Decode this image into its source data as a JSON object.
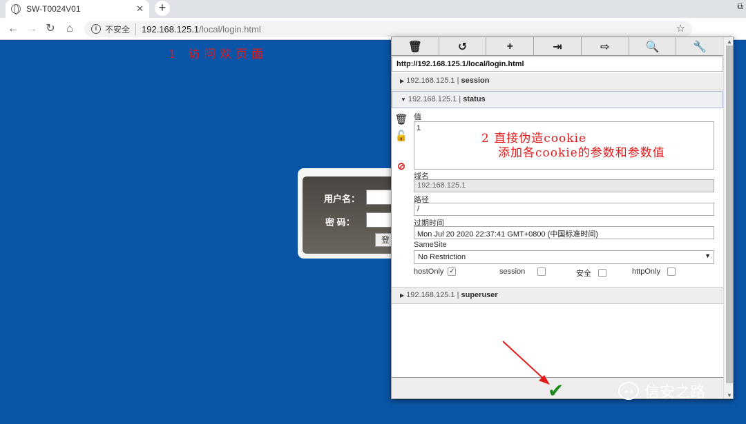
{
  "browser": {
    "tab_title": "SW-T0024V01",
    "tab_close": "✕",
    "new_tab": "+",
    "window_control": "⧉",
    "insecure_label": "不安全",
    "url_host": "192.168.125.1",
    "url_path": "/local/login.html",
    "nav": {
      "back": "←",
      "forward": "→",
      "reload": "↻",
      "home": "⌂"
    },
    "star": "☆",
    "extension_icon": "⚡"
  },
  "page": {
    "annotation_1": "1 访问欢页面",
    "login": {
      "username_label": "用户名：",
      "password_label": "密 码：",
      "login_button": "登"
    }
  },
  "cookie_panel": {
    "toolbar_icons": [
      "trash-icon",
      "undo-icon",
      "plus-icon",
      "import-icon",
      "export-icon",
      "search-icon",
      "wrench-icon"
    ],
    "toolbar_glyphs": [
      "🗑",
      "↺",
      "+",
      "⇥",
      "⇨",
      "🔍",
      "🔧"
    ],
    "url": "http://192.168.125.1/local/login.html",
    "cookies": [
      {
        "host": "192.168.125.1",
        "sep": " | ",
        "name": "session"
      },
      {
        "host": "192.168.125.1",
        "sep": " | ",
        "name": "status"
      },
      {
        "host": "192.168.125.1",
        "sep": " | ",
        "name": "superuser"
      }
    ],
    "side_icons": {
      "delete": "🗑",
      "lock": "🔓",
      "block": "⊘"
    },
    "fields": {
      "value_label": "值",
      "value": "1",
      "domain_label": "域名",
      "domain": "192.168.125.1",
      "path_label": "路径",
      "path": "/",
      "expires_label": "过期时间",
      "expires": "Mon Jul 20 2020 22:37:41 GMT+0800 (中国标准时间)",
      "samesite_label": "SameSite",
      "samesite": "No Restriction",
      "hostonly_label": "hostOnly",
      "session_label": "session",
      "secure_label": "安全",
      "httponly_label": "httpOnly",
      "hostonly_checked": true,
      "session_checked": false,
      "secure_checked": false,
      "httponly_checked": false
    },
    "annotation_2_line1": "2 直接伪造cookie",
    "annotation_2_line2": "添加各cookie的参数和参数值",
    "save_glyph": "✔"
  },
  "watermark": {
    "text": "信安之路"
  }
}
